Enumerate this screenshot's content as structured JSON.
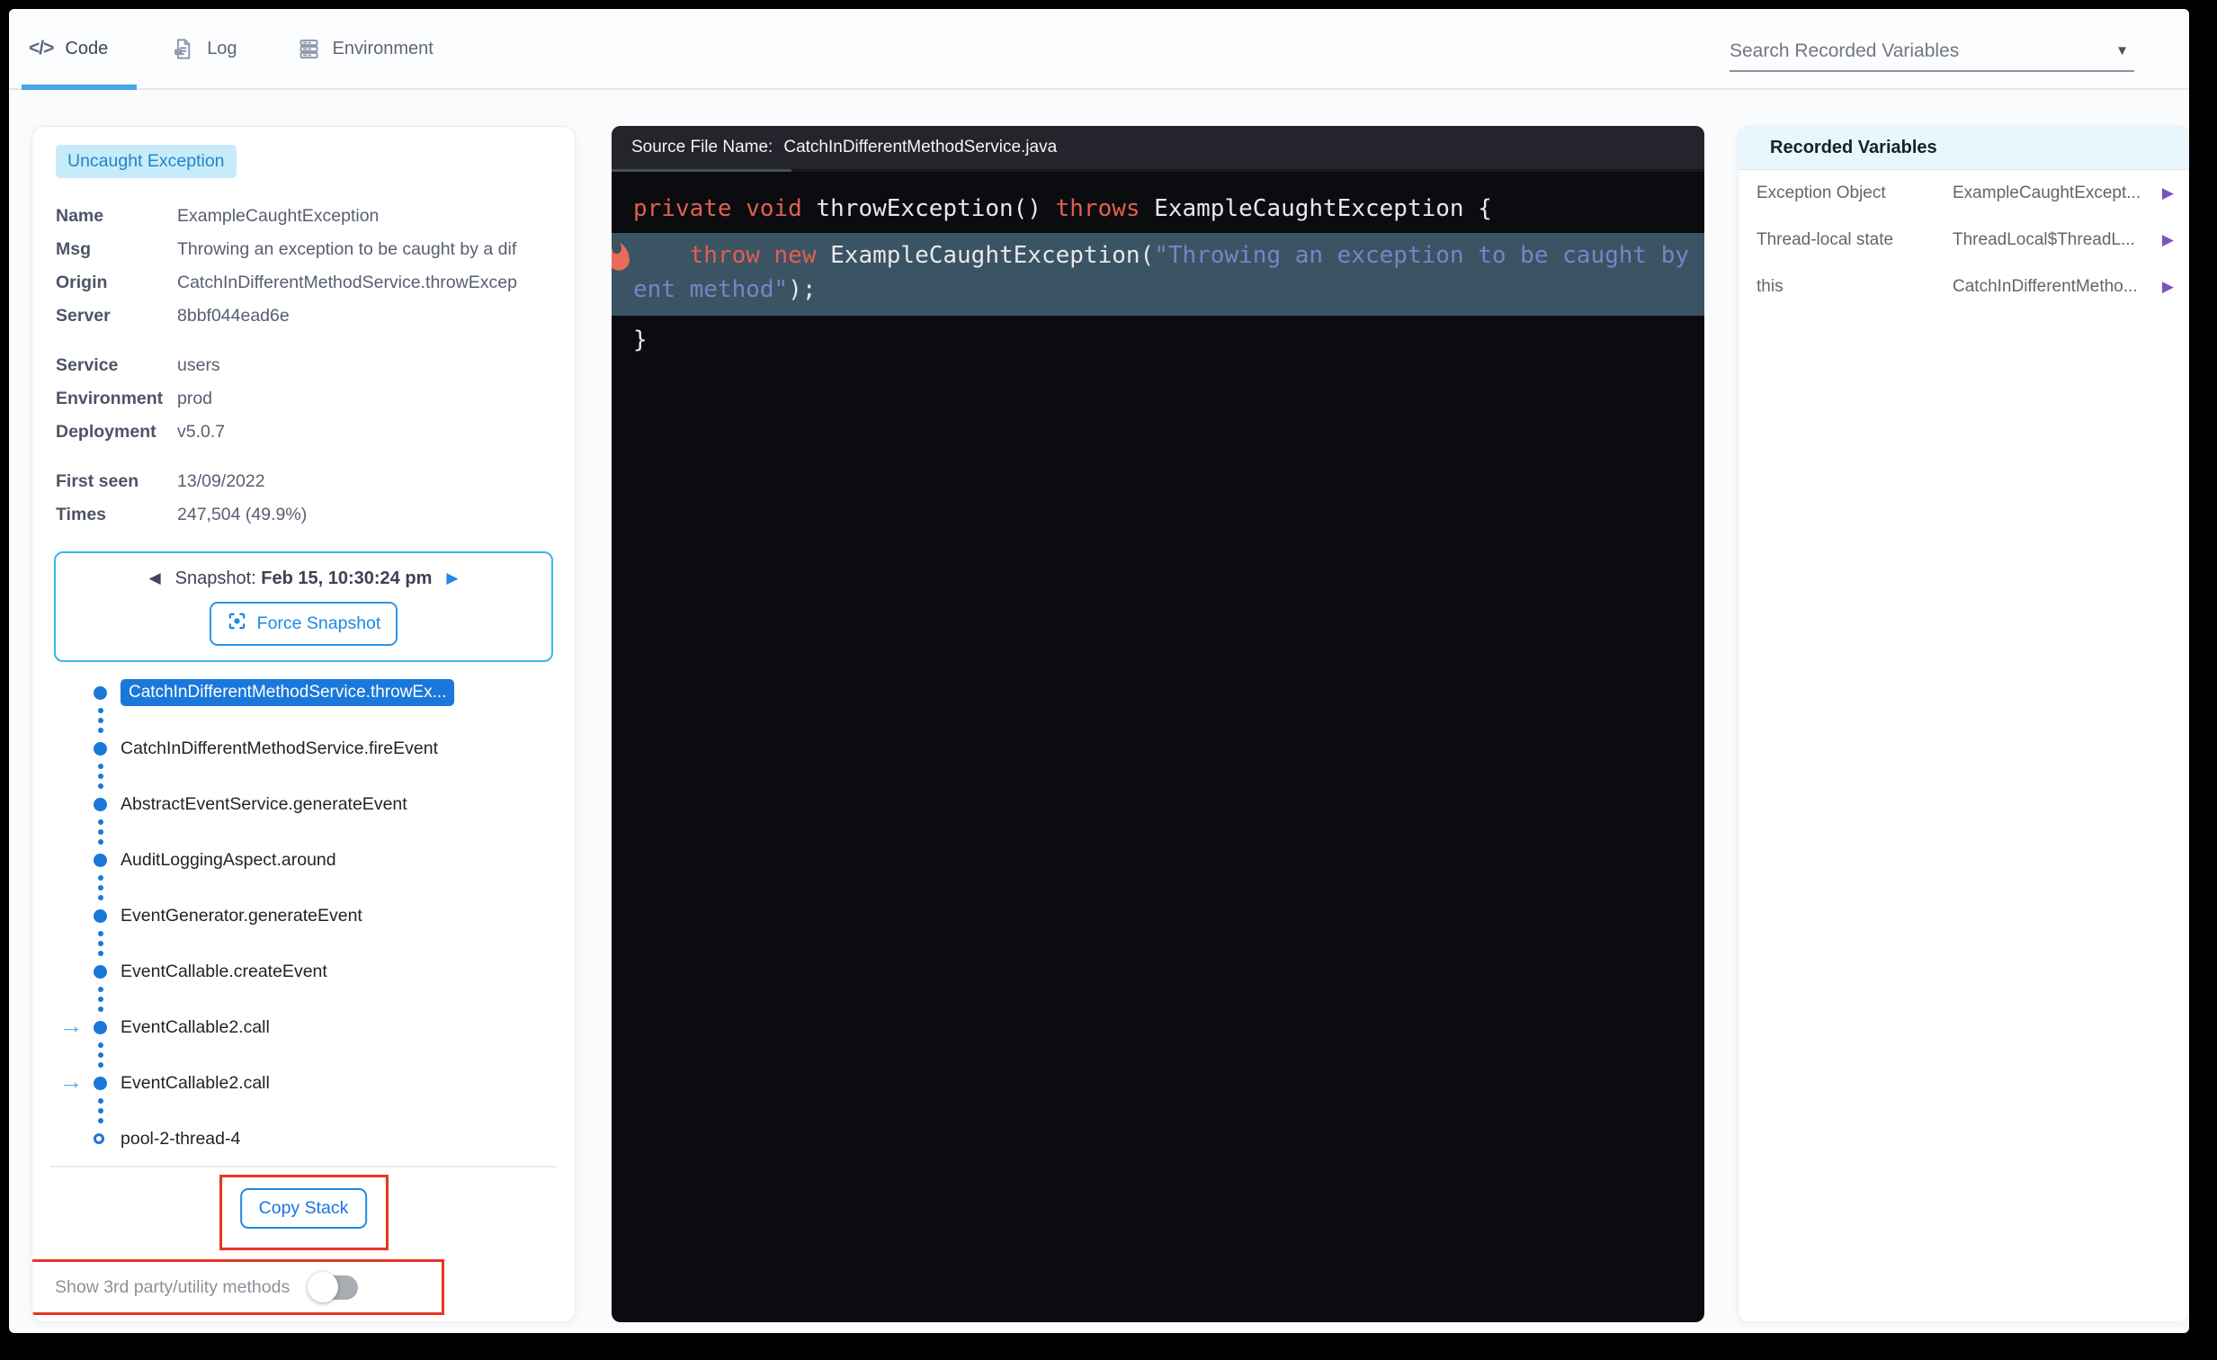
{
  "tabs": [
    {
      "label": "Code",
      "active": true
    },
    {
      "label": "Log",
      "active": false
    },
    {
      "label": "Environment",
      "active": false
    }
  ],
  "search": {
    "label": "Search Recorded Variables"
  },
  "icons": {
    "code_glyph": "</>",
    "caret_down": "▼",
    "arrow_left": "◀",
    "arrow_right": "▶",
    "stack_arrow": "→",
    "play_right": "▶"
  },
  "exception": {
    "badge": "Uncaught Exception",
    "rows_a": [
      {
        "label": "Name",
        "value": "ExampleCaughtException"
      },
      {
        "label": "Msg",
        "value": "Throwing an exception to be caught by a dif"
      },
      {
        "label": "Origin",
        "value": "CatchInDifferentMethodService.throwExcep"
      },
      {
        "label": "Server",
        "value": "8bbf044ead6e"
      }
    ],
    "rows_b": [
      {
        "label": "Service",
        "value": "users"
      },
      {
        "label": "Environment",
        "value": "prod"
      },
      {
        "label": "Deployment",
        "value": "v5.0.7"
      }
    ],
    "rows_c": [
      {
        "label": "First seen",
        "value": "13/09/2022"
      },
      {
        "label": "Times",
        "value": "247,504 (49.9%)"
      }
    ]
  },
  "snapshot": {
    "label": "Snapshot: ",
    "datetime": "Feb 15, 10:30:24 pm",
    "force_label": "Force Snapshot"
  },
  "stack": {
    "items": [
      {
        "label": "CatchInDifferentMethodService.throwEx..."
      },
      {
        "label": "CatchInDifferentMethodService.fireEvent"
      },
      {
        "label": "AbstractEventService.generateEvent"
      },
      {
        "label": "AuditLoggingAspect.around"
      },
      {
        "label": "EventGenerator.generateEvent"
      },
      {
        "label": "EventCallable.createEvent"
      },
      {
        "label": "EventCallable2.call"
      },
      {
        "label": "EventCallable2.call"
      },
      {
        "label": "pool-2-thread-4"
      }
    ],
    "copy_label": "Copy Stack",
    "toggle_label": "Show 3rd party/utility methods",
    "toggle_on": false
  },
  "code": {
    "header_label": "Source File Name:",
    "file_name": "CatchInDifferentMethodService.java",
    "line1": {
      "kw1": "private void",
      "p1": " throwException() ",
      "kw2": "throws",
      "p2": " ExampleCaughtException {"
    },
    "hl": {
      "kw": "    throw new",
      "p1": " ExampleCaughtException(",
      "str1": "\"Throwing an exception to be caught by a differ",
      "str2": "ent method\"",
      "p2": ");"
    },
    "line3": "}"
  },
  "variables": {
    "title": "Recorded Variables",
    "rows": [
      {
        "name": "Exception Object",
        "value": "ExampleCaughtExcept..."
      },
      {
        "name": "Thread-local state",
        "value": "ThreadLocal$ThreadL..."
      },
      {
        "name": "this",
        "value": "CatchInDifferentMetho..."
      }
    ]
  },
  "colors": {
    "accent_blue": "#1e88e5",
    "tab_underline": "#45a7e4",
    "badge_bg": "#c8ebfa",
    "badge_text": "#1e86c8",
    "snapshot_border": "#38b6ef",
    "code_keyword": "#e0604e",
    "code_string": "#7386c6",
    "code_highlight_bg": "#3a5464",
    "flame": "#ed6a5a",
    "annotation_red": "#ea3424",
    "variable_expander_purple": "#7c53c5"
  }
}
